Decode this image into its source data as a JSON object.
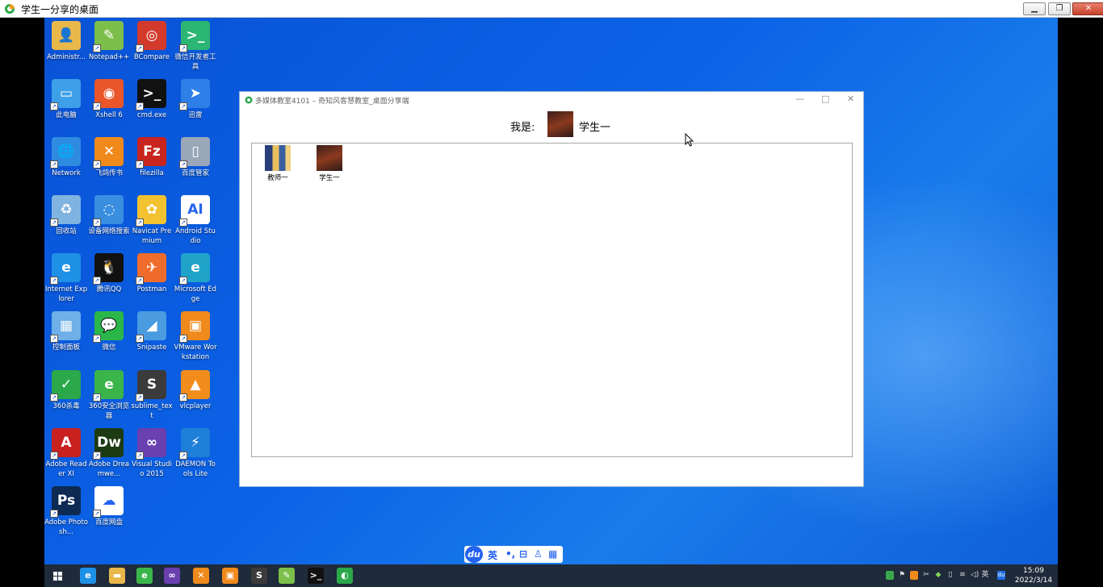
{
  "outer_window": {
    "title": "学生一分享的桌面",
    "minimize_label": "▁",
    "restore_label": "❐",
    "close_label": "✕"
  },
  "desktop_icons": [
    {
      "label": "Administr...",
      "icon": "user-folder-icon",
      "color": "#e8b84a",
      "glyph": "👤"
    },
    {
      "label": "Notepad++",
      "icon": "notepad-plus-icon",
      "color": "#7cbf4a",
      "glyph": "✎"
    },
    {
      "label": "BCompare",
      "icon": "bcompare-icon",
      "color": "#d33a2c",
      "glyph": "◎"
    },
    {
      "label": "微信开发者工具",
      "icon": "wechat-devtools-icon",
      "color": "#2bb673",
      "glyph": ">_"
    },
    {
      "label": "此电脑",
      "icon": "this-pc-icon",
      "color": "#3ea0e8",
      "glyph": "▭"
    },
    {
      "label": "Xshell 6",
      "icon": "xshell-icon",
      "color": "#e8562a",
      "glyph": "◉"
    },
    {
      "label": "cmd.exe",
      "icon": "cmd-icon",
      "color": "#111111",
      "glyph": ">_"
    },
    {
      "label": "迅雷",
      "icon": "xunlei-icon",
      "color": "#2f7fe8",
      "glyph": "➤"
    },
    {
      "label": "Network",
      "icon": "network-icon",
      "color": "#2f8be0",
      "glyph": "🌐"
    },
    {
      "label": "飞鸽传书",
      "icon": "feige-icon",
      "color": "#f08a1c",
      "glyph": "✕"
    },
    {
      "label": "filezilla",
      "icon": "filezilla-icon",
      "color": "#c8251e",
      "glyph": "Fz"
    },
    {
      "label": "百度管家",
      "icon": "mouse-icon",
      "color": "#9aa7b8",
      "glyph": "▯"
    },
    {
      "label": "回收站",
      "icon": "recycle-bin-icon",
      "color": "#7fb4e0",
      "glyph": "♻"
    },
    {
      "label": "设备网络搜索",
      "icon": "device-search-icon",
      "color": "#3a8ee0",
      "glyph": "◌"
    },
    {
      "label": "Navicat Premium",
      "icon": "navicat-icon",
      "color": "#f2c230",
      "glyph": "✿"
    },
    {
      "label": "Android Studio",
      "icon": "android-studio-icon",
      "color": "#ffffff",
      "glyph": "AI"
    },
    {
      "label": "Internet Explorer",
      "icon": "ie-icon",
      "color": "#1e90e6",
      "glyph": "e"
    },
    {
      "label": "腾讯QQ",
      "icon": "qq-icon",
      "color": "#111111",
      "glyph": "🐧"
    },
    {
      "label": "Postman",
      "icon": "postman-icon",
      "color": "#ef6c2c",
      "glyph": "✈"
    },
    {
      "label": "Microsoft Edge",
      "icon": "edge-icon",
      "color": "#1fa3c9",
      "glyph": "e"
    },
    {
      "label": "控制面板",
      "icon": "control-panel-icon",
      "color": "#6fb0e8",
      "glyph": "▦"
    },
    {
      "label": "微信",
      "icon": "wechat-icon",
      "color": "#2bb64a",
      "glyph": "💬"
    },
    {
      "label": "Snipaste",
      "icon": "snipaste-icon",
      "color": "#4a9be0",
      "glyph": "◢"
    },
    {
      "label": "VMware Workstation",
      "icon": "vmware-icon",
      "color": "#f08a1c",
      "glyph": "▣"
    },
    {
      "label": "360杀毒",
      "icon": "360-antivirus-icon",
      "color": "#2aa84a",
      "glyph": "✓"
    },
    {
      "label": "360安全浏览器",
      "icon": "360-browser-icon",
      "color": "#3ab54a",
      "glyph": "e"
    },
    {
      "label": "sublime_text",
      "icon": "sublime-text-icon",
      "color": "#3b3b3b",
      "glyph": "S"
    },
    {
      "label": "vlcplayer",
      "icon": "vlc-icon",
      "color": "#f28c1b",
      "glyph": "▲"
    },
    {
      "label": "Adobe Reader XI",
      "icon": "adobe-reader-icon",
      "color": "#c8201e",
      "glyph": "A"
    },
    {
      "label": "Adobe Dreamwe...",
      "icon": "dreamweaver-icon",
      "color": "#1c3b12",
      "glyph": "Dw"
    },
    {
      "label": "Visual Studio 2015",
      "icon": "visual-studio-icon",
      "color": "#6a3fb0",
      "glyph": "∞"
    },
    {
      "label": "DAEMON Tools Lite",
      "icon": "daemon-tools-icon",
      "color": "#1e7fd8",
      "glyph": "⚡"
    },
    {
      "label": "Adobe Photosh...",
      "icon": "photoshop-icon",
      "color": "#0c2a52",
      "glyph": "Ps"
    },
    {
      "label": "百度网盘",
      "icon": "baidu-netdisk-icon",
      "color": "#ffffff",
      "glyph": "☁"
    }
  ],
  "share_window": {
    "title": "多媒体教室4101 – 奇知风客慧教室_桌面分享端",
    "minimize_label": "—",
    "maximize_label": "□",
    "close_label": "✕",
    "iam_label": "我是:",
    "me_name": "学生一",
    "members": [
      {
        "name": "教师一",
        "avatar": "teacher-avatar"
      },
      {
        "name": "学生一",
        "avatar": "student-avatar"
      }
    ]
  },
  "ime_bar": {
    "logo": "du",
    "lang": "英",
    "punct": "•,",
    "toolbox": "⊟",
    "user": "♙",
    "grid": "▦"
  },
  "taskbar": {
    "start": "start-icon",
    "apps": [
      {
        "icon": "ie-icon",
        "color": "#1e90e6",
        "glyph": "e"
      },
      {
        "icon": "file-explorer-icon",
        "color": "#e8b84a",
        "glyph": "▬"
      },
      {
        "icon": "360-browser-icon",
        "color": "#3ab54a",
        "glyph": "e"
      },
      {
        "icon": "visual-studio-icon",
        "color": "#6a3fb0",
        "glyph": "∞"
      },
      {
        "icon": "feige-icon",
        "color": "#f08a1c",
        "glyph": "✕"
      },
      {
        "icon": "vmware-icon",
        "color": "#f08a1c",
        "glyph": "▣"
      },
      {
        "icon": "sublime-text-icon",
        "color": "#3b3b3b",
        "glyph": "S"
      },
      {
        "icon": "notepad-plus-icon",
        "color": "#7cbf4a",
        "glyph": "✎"
      },
      {
        "icon": "cmd-icon",
        "color": "#111111",
        "glyph": ">_"
      },
      {
        "icon": "share-app-icon",
        "color": "#2aa84a",
        "glyph": "◐"
      }
    ],
    "tray_lang": "英",
    "time": "15:09",
    "date": "2022/3/14"
  }
}
